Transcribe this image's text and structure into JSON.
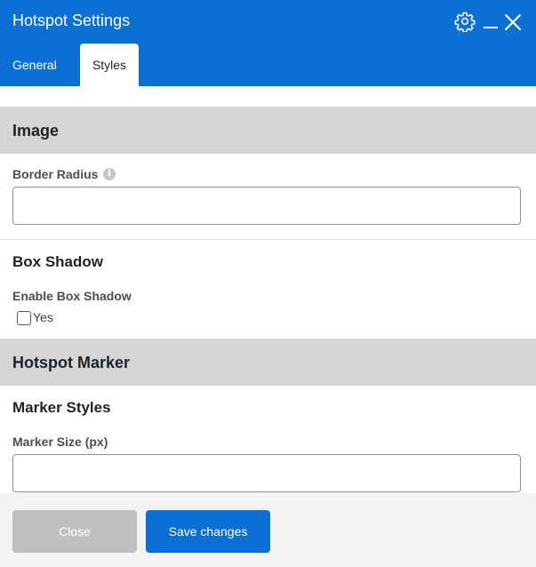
{
  "dialog": {
    "title": "Hotspot Settings",
    "icons": {
      "settings": "gear-icon",
      "minimize": "minimize-icon",
      "close": "close-icon"
    }
  },
  "tabs": [
    {
      "label": "General",
      "active": false
    },
    {
      "label": "Styles",
      "active": true
    }
  ],
  "sections": {
    "image": {
      "heading": "Image",
      "border_radius": {
        "label": "Border Radius",
        "value": "",
        "info_icon": "info-icon"
      }
    },
    "box_shadow": {
      "heading": "Box Shadow",
      "enable": {
        "label": "Enable Box Shadow",
        "option_label": "Yes",
        "checked": false
      }
    },
    "hotspot_marker": {
      "heading": "Hotspot Marker",
      "marker_styles": {
        "heading": "Marker Styles",
        "marker_size": {
          "label": "Marker Size (px)",
          "value": ""
        }
      }
    }
  },
  "footer": {
    "close_label": "Close",
    "save_label": "Save changes"
  },
  "colors": {
    "primary": "#0b6fd3",
    "section_band": "#d5d5d5",
    "footer_bg": "#f3f3f3",
    "disabled_button": "#bfbfbf"
  }
}
